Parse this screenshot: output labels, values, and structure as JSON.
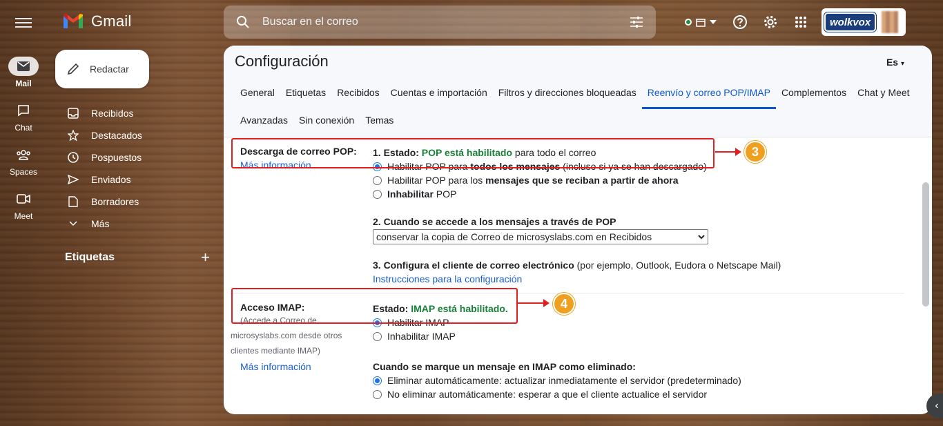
{
  "rail": {
    "items": [
      {
        "label": "Mail"
      },
      {
        "label": "Chat"
      },
      {
        "label": "Spaces"
      },
      {
        "label": "Meet"
      }
    ]
  },
  "app": {
    "logo_text": "Gmail"
  },
  "compose": {
    "label": "Redactar"
  },
  "nav": {
    "items": [
      {
        "label": "Recibidos"
      },
      {
        "label": "Destacados"
      },
      {
        "label": "Pospuestos"
      },
      {
        "label": "Enviados"
      },
      {
        "label": "Borradores"
      },
      {
        "label": "Más"
      }
    ],
    "labels_title": "Etiquetas"
  },
  "search": {
    "placeholder": "Buscar en el correo"
  },
  "account": {
    "brand": "wolkvox"
  },
  "page": {
    "title": "Configuración",
    "lang": "Es"
  },
  "tabs": [
    {
      "label": "General"
    },
    {
      "label": "Etiquetas"
    },
    {
      "label": "Recibidos"
    },
    {
      "label": "Cuentas e importación"
    },
    {
      "label": "Filtros y direcciones bloqueadas"
    },
    {
      "label": "Reenvío y correo POP/IMAP"
    },
    {
      "label": "Complementos"
    },
    {
      "label": "Chat y Meet"
    },
    {
      "label": "Avanzadas"
    },
    {
      "label": "Sin conexión"
    },
    {
      "label": "Temas"
    }
  ],
  "pop": {
    "label": "Descarga de correo POP:",
    "more": "Más información",
    "status_prefix": "1. Estado: ",
    "status_green": "POP está habilitado",
    "status_suffix": " para todo el correo",
    "opt1_a": "Habilitar POP para ",
    "opt1_b": "todos los mensajes",
    "opt1_c": " (incluso si ya se han descargado)",
    "opt2_a": "Habilitar POP para los ",
    "opt2_b": "mensajes que se reciban a partir de ahora",
    "opt3_a": "Inhabilitar",
    "opt3_b": " POP",
    "q2": "2. Cuando se accede a los mensajes a través de POP",
    "select_value": "conservar la copia de Correo de microsyslabs.com en Recibidos",
    "q3_a": "3. Configura el cliente de correo electrónico",
    "q3_b": " (por ejemplo, Outlook, Eudora o Netscape Mail)",
    "instructions": "Instrucciones para la configuración",
    "badge": "3"
  },
  "imap": {
    "label": "Acceso IMAP:",
    "sub1": "(Accede a Correo de",
    "sub2": "microsyslabs.com desde otros",
    "sub3": "clientes mediante IMAP)",
    "more": "Más información",
    "status_prefix": "Estado: ",
    "status_green": "IMAP está habilitado.",
    "opt1": "Habilitar IMAP",
    "opt2": "Inhabilitar IMAP",
    "q_delete": "Cuando se marque un mensaje en IMAP como eliminado:",
    "del_opt1": "Eliminar automáticamente: actualizar inmediatamente el servidor (predeterminado)",
    "del_opt2": "No eliminar automáticamente: esperar a que el cliente actualice el servidor",
    "badge": "4"
  },
  "colors": {
    "accent": "#0b57d0",
    "green": "#188038",
    "highlight": "#e02020",
    "badge": "#f0a020"
  }
}
